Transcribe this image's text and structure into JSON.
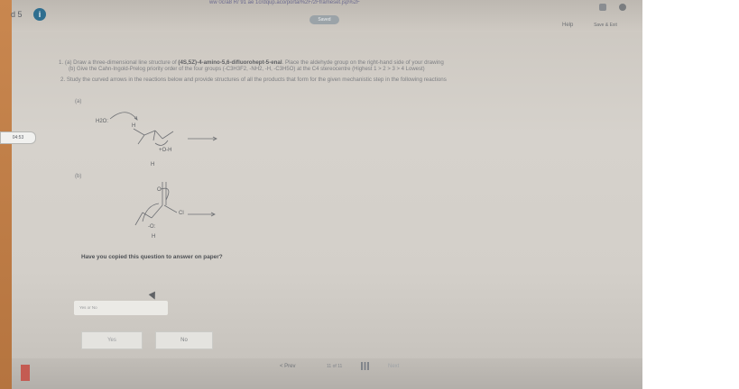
{
  "header": {
    "page_number": "d 5",
    "url_text": "ww 0c/a8 R/ 91 ae 1crdqup.aco/portal%2F/2Fframeset.jsp%2F",
    "saved_label": "Saved",
    "help_label": "Help",
    "save_exit_label": "Save & Exit"
  },
  "timer": "04:53",
  "question": {
    "q1a_prefix": "1. (a) Draw a three-dimensional line structure of ",
    "q1a_bold": "(4S,5Z)-4-amino-5,6-difluorohept-5-enal",
    "q1a_suffix": ". Place the aldehyde group on the right-hand side of your drawing",
    "q1b": "(b) Give the Cahn-Ingold-Prelog priority order of the four groups (-C3H3F2, -NH2, -H, -C3H5O) at the C4 stereocentre (Highest 1 > 2 > 3 > 4 Lowest)",
    "q2": "2. Study the curved arrows in the reactions below and provide structures of all the products that form for the given mechanistic step in the following reactions",
    "part_a": "(a)",
    "part_b": "(b)"
  },
  "structure_labels": {
    "water": "H2O:",
    "h_top": "H",
    "oh": "+O-H",
    "h_bottom": "H",
    "carbonyl_o": "O",
    "chlorine": "Cl",
    "alkoxide_o": "-O:",
    "h_alkoxide": "H"
  },
  "copied_question": "Have you copied this question to answer on paper?",
  "select_placeholder": "Yes or No",
  "answers": {
    "yes": "Yes",
    "no": "No"
  },
  "footer": {
    "prev": "< Prev",
    "counter": "11 of 11",
    "next": "Next"
  },
  "colors": {
    "accent_orange": "#c9874f",
    "info_blue": "#2f6e8f"
  }
}
